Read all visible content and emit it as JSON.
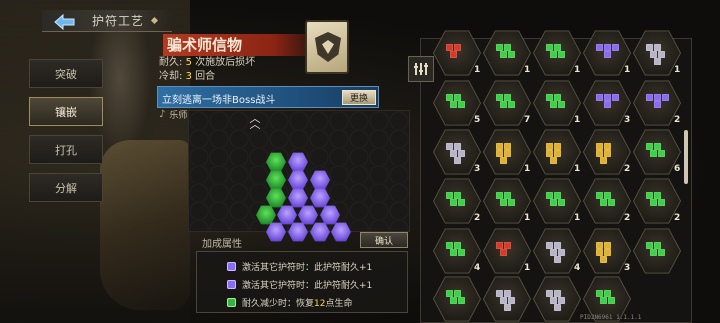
{
  "header": {
    "title": "护符工艺",
    "back_icon": "back-arrow-icon"
  },
  "side_tabs": [
    {
      "label": "突破",
      "active": false
    },
    {
      "label": "镶嵌",
      "active": true
    },
    {
      "label": "打孔",
      "active": false
    },
    {
      "label": "分解",
      "active": false
    }
  ],
  "charm": {
    "name": "骗术师信物",
    "durability_label": "耐久:",
    "durability_value": "5",
    "durability_suffix": "次施放后损坏",
    "cooldown_label": "冷却:",
    "cooldown_value": "3",
    "cooldown_suffix": "回合",
    "description": "立刻逃离一场非Boss战斗",
    "replace_label": "更换",
    "owner_text": "乐师 专用护符",
    "colors": {
      "name_bg": "#b33a22",
      "desc_bg": "#2f6fa3",
      "highlight": "#ffd54a"
    }
  },
  "board": {
    "hexes": [
      {
        "color": "green"
      },
      {
        "color": "purple"
      },
      {
        "color": "green"
      },
      {
        "color": "purple"
      },
      {
        "color": "purple"
      },
      {
        "color": "green"
      },
      {
        "color": "purple"
      },
      {
        "color": "purple"
      },
      {
        "color": "green"
      },
      {
        "color": "purple"
      },
      {
        "color": "purple"
      },
      {
        "color": "purple"
      },
      {
        "color": "purple"
      },
      {
        "color": "purple"
      },
      {
        "color": "purple"
      },
      {
        "color": "purple"
      }
    ]
  },
  "bonus": {
    "title": "加成属性",
    "confirm_label": "确认",
    "lines": [
      {
        "gem": "purple",
        "text_a": "激活其它护符时：此护符耐久+",
        "text_b": "1"
      },
      {
        "gem": "purple",
        "text_a": "激活其它护符时：此护符耐久+",
        "text_b": "1"
      },
      {
        "gem": "green",
        "text_a": "耐久减少时：恢复",
        "value": "12",
        "text_b": "点生命"
      }
    ]
  },
  "inventory": {
    "filter_icon": "filter-bars-icon",
    "version_text": "PID2N6961 1.1.1.1",
    "cells": [
      {
        "color": "red",
        "count": "1"
      },
      {
        "color": "green",
        "count": "1"
      },
      {
        "color": "green",
        "count": "1"
      },
      {
        "color": "purple",
        "count": "1"
      },
      {
        "color": "silver",
        "count": "1"
      },
      {
        "color": "green",
        "count": "5"
      },
      {
        "color": "green",
        "count": "7"
      },
      {
        "color": "green",
        "count": "1"
      },
      {
        "color": "purple",
        "count": "3"
      },
      {
        "color": "purple",
        "count": "2"
      },
      {
        "color": "silver",
        "count": "3"
      },
      {
        "color": "gold",
        "count": "1"
      },
      {
        "color": "gold",
        "count": "1"
      },
      {
        "color": "gold",
        "count": "2"
      },
      {
        "color": "green",
        "count": "6"
      },
      {
        "color": "green",
        "count": "2"
      },
      {
        "color": "green",
        "count": "1"
      },
      {
        "color": "green",
        "count": "1"
      },
      {
        "color": "green",
        "count": "2"
      },
      {
        "color": "green",
        "count": "2"
      },
      {
        "color": "green",
        "count": "4"
      },
      {
        "color": "red",
        "count": "1"
      },
      {
        "color": "silver",
        "count": "4"
      },
      {
        "color": "gold",
        "count": "3"
      },
      {
        "color": "green",
        "count": ""
      },
      {
        "color": "green",
        "count": ""
      },
      {
        "color": "silver",
        "count": ""
      },
      {
        "color": "silver",
        "count": ""
      },
      {
        "color": "green",
        "count": ""
      }
    ]
  }
}
